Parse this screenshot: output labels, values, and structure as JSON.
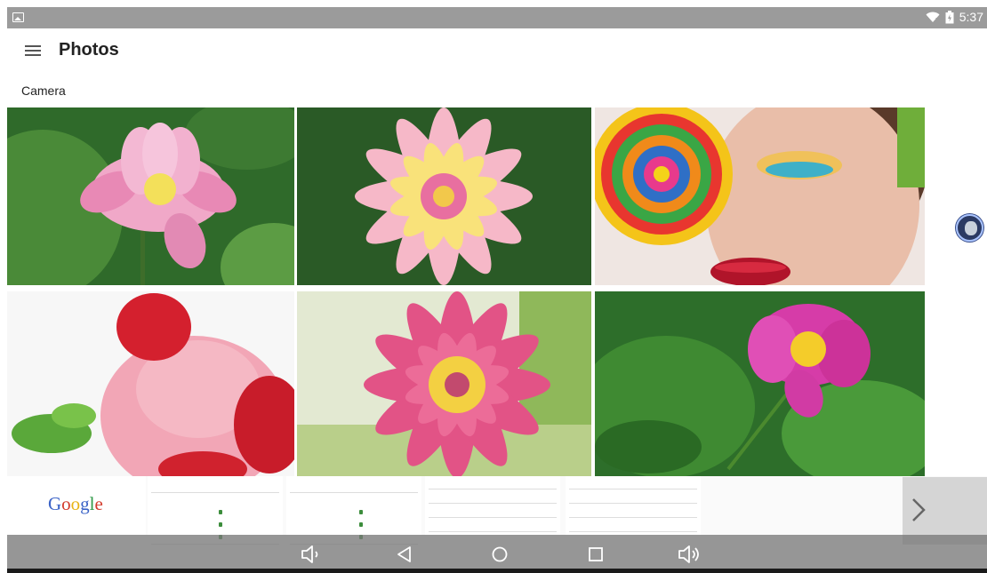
{
  "status_bar": {
    "time": "5:37",
    "icons": [
      "gallery-notification-icon",
      "wifi-icon",
      "battery-icon"
    ]
  },
  "header": {
    "title": "Photos",
    "menu_icon": "hamburger-menu-icon"
  },
  "section": {
    "label": "Camera"
  },
  "photos": [
    {
      "name": "pink-lotus-photo"
    },
    {
      "name": "pink-yellow-dahlia-photo"
    },
    {
      "name": "lollipop-woman-photo"
    },
    {
      "name": "strawberry-ice-cream-photo"
    },
    {
      "name": "pink-water-lily-photo"
    },
    {
      "name": "magenta-peony-photo"
    }
  ],
  "recents": {
    "google_logo": [
      "G",
      "o",
      "o",
      "g",
      "l",
      "e"
    ],
    "google_colors": [
      "#3b63c7",
      "#d33b2c",
      "#e8b316",
      "#3b63c7",
      "#2f9a48",
      "#d33b2c"
    ],
    "next_icon": "chevron-right-icon"
  },
  "nav_bar": {
    "buttons": [
      "volume-down-icon",
      "back-icon",
      "home-icon",
      "recents-icon",
      "volume-up-icon"
    ]
  }
}
